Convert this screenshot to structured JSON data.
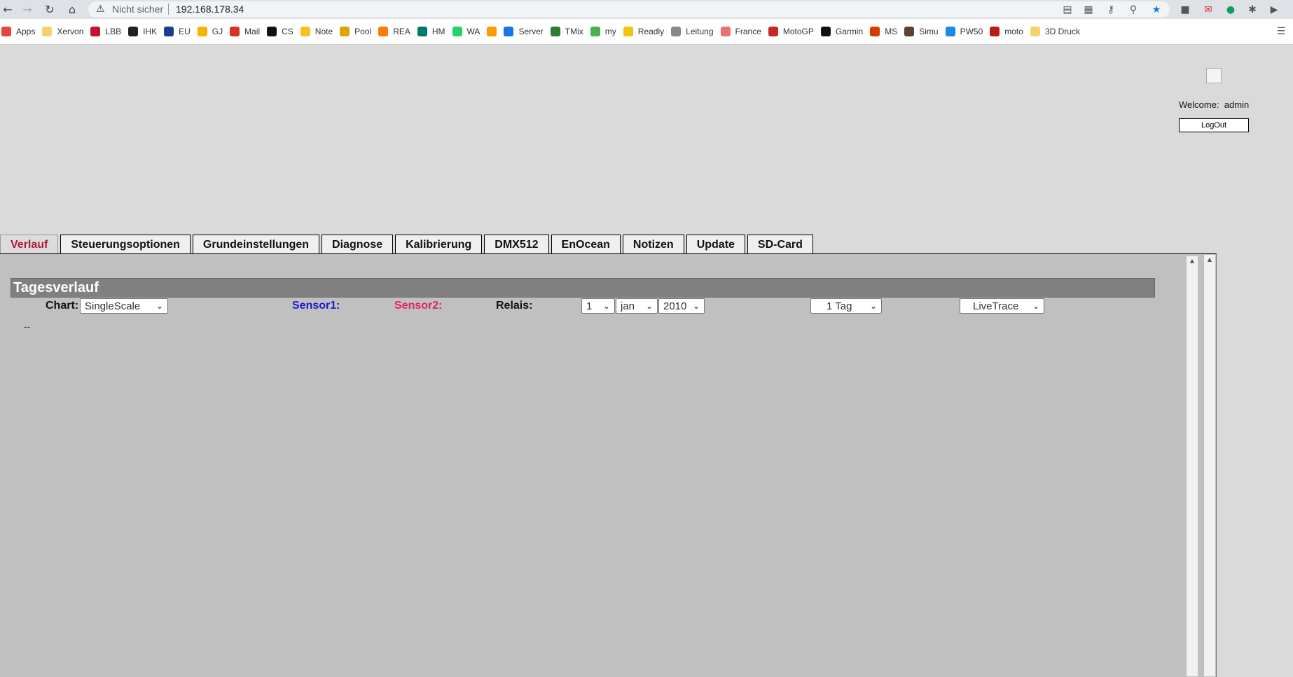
{
  "browser": {
    "security_label": "Nicht sicher",
    "url": "192.168.178.34",
    "bookmarks": [
      {
        "label": "Apps",
        "color": "#e8453c"
      },
      {
        "label": "Xervon",
        "color": "#f5d36b"
      },
      {
        "label": "LBB",
        "color": "#c0122c"
      },
      {
        "label": "IHK",
        "color": "#222222"
      },
      {
        "label": "EU",
        "color": "#1a3d8f"
      },
      {
        "label": "GJ",
        "color": "#f4b400"
      },
      {
        "label": "Mail",
        "color": "#d93025"
      },
      {
        "label": "CS",
        "color": "#111111"
      },
      {
        "label": "Note",
        "color": "#f6c026"
      },
      {
        "label": "Pool",
        "color": "#e0a400"
      },
      {
        "label": "REA",
        "color": "#ff7a00"
      },
      {
        "label": "HM",
        "color": "#00796b"
      },
      {
        "label": "WA",
        "color": "#25d366"
      },
      {
        "label": "",
        "color": "#ff9900"
      },
      {
        "label": "Server",
        "color": "#1a73e8"
      },
      {
        "label": "TMix",
        "color": "#2e7d32"
      },
      {
        "label": "my",
        "color": "#4caf50"
      },
      {
        "label": "Readly",
        "color": "#f4c20d"
      },
      {
        "label": "Leitung",
        "color": "#888888"
      },
      {
        "label": "France",
        "color": "#e57373"
      },
      {
        "label": "MotoGP",
        "color": "#c62828"
      },
      {
        "label": "Garmin",
        "color": "#111111"
      },
      {
        "label": "MS",
        "color": "#d83b01"
      },
      {
        "label": "Simu",
        "color": "#5d4037"
      },
      {
        "label": "PW50",
        "color": "#1e88e5"
      },
      {
        "label": "moto",
        "color": "#b71c1c"
      },
      {
        "label": "3D Druck",
        "color": "#f5d36b"
      }
    ]
  },
  "header": {
    "welcome_label": "Welcome:",
    "user": "admin",
    "logout_label": "LogOut"
  },
  "tabs": [
    {
      "label": "Verlauf",
      "active": true
    },
    {
      "label": "Steuerungsoptionen",
      "active": false
    },
    {
      "label": "Grundeinstellungen",
      "active": false
    },
    {
      "label": "Diagnose",
      "active": false
    },
    {
      "label": "Kalibrierung",
      "active": false
    },
    {
      "label": "DMX512",
      "active": false
    },
    {
      "label": "EnOcean",
      "active": false
    },
    {
      "label": "Notizen",
      "active": false
    },
    {
      "label": "Update",
      "active": false
    },
    {
      "label": "SD-Card",
      "active": false
    }
  ],
  "section": {
    "title": "Tagesverlauf",
    "chart_label": "Chart:",
    "chart_value": "SingleScale",
    "sensor1_label": "Sensor1:",
    "sensor2_label": "Sensor2:",
    "relais_label": "Relais:",
    "day_value": "1",
    "month_value": "jan",
    "year_value": "2010",
    "range_value": "1 Tag",
    "mode_value": "LiveTrace",
    "placeholder_text": "--"
  },
  "colors": {
    "sensor1": "#1a1acc",
    "sensor2": "#e0245e",
    "active_tab": "#b0163b"
  }
}
